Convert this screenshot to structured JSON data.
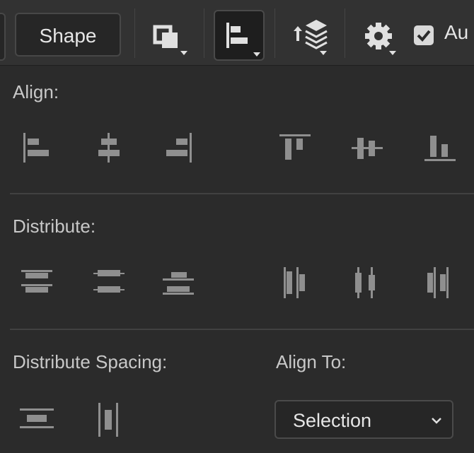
{
  "toolbar": {
    "shape_label": "Shape",
    "auto_label": "Au",
    "icons": [
      "path-operations-icon",
      "path-alignment-icon",
      "path-arrangement-icon",
      "settings-gear-icon"
    ]
  },
  "panel": {
    "align_label": "Align:",
    "distribute_label": "Distribute:",
    "distribute_spacing_label": "Distribute Spacing:",
    "align_to_label": "Align To:",
    "align_to_value": "Selection"
  },
  "colors": {
    "background": "#2b2b2b",
    "toolbar": "#323232",
    "icon": "#8f8f8f",
    "text": "#c8c8c8"
  }
}
